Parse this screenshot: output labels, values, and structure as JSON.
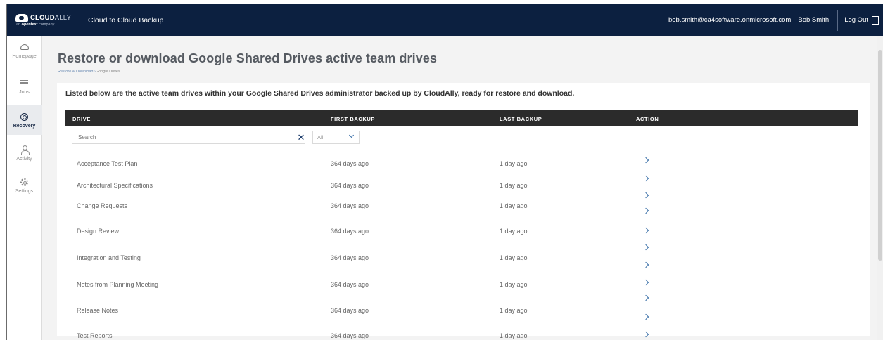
{
  "header": {
    "logo_text_bold": "CLOUD",
    "logo_text_light": "ALLY",
    "logo_sub_prefix": "an",
    "logo_sub_brand": "opentext",
    "logo_sub_suffix": "company",
    "app_title": "Cloud to Cloud Backup",
    "user_email": "bob.smith@ca4software.onmicrosoft.com",
    "user_name": "Bob Smith",
    "logout_label": "Log Out"
  },
  "sidebar": {
    "items": [
      {
        "label": "Homepage",
        "icon": "cloud-icon"
      },
      {
        "label": "Jobs",
        "icon": "stack-icon"
      },
      {
        "label": "Recovery",
        "icon": "recovery-icon",
        "active": true
      },
      {
        "label": "Activity",
        "icon": "person-icon"
      },
      {
        "label": "Settings",
        "icon": "gear-icon"
      }
    ]
  },
  "page": {
    "title": "Restore or download Google Shared Drives active team drives",
    "breadcrumb_parent": "Restore & Download",
    "breadcrumb_sep": " ›",
    "breadcrumb_current": "Google Drives",
    "intro": "Listed below are the active team drives within your Google Shared Drives administrator backed up by CloudAlly, ready for restore and download."
  },
  "table": {
    "columns": [
      "DRIVE",
      "FIRST BACKUP",
      "LAST BACKUP",
      "ACTION"
    ],
    "search_placeholder": "Search",
    "filter_value": "All",
    "rows": [
      {
        "drive": "Acceptance Test Plan",
        "first": "364 days ago",
        "last": "1 day ago"
      },
      {
        "drive": "Architectural Specifications",
        "first": "364 days ago",
        "last": "1 day ago"
      },
      {
        "drive": "Change Requests",
        "first": "364 days ago",
        "last": "1 day ago"
      },
      {
        "drive": "Design Review",
        "first": "364 days ago",
        "last": "1 day ago"
      },
      {
        "drive": "Integration and Testing",
        "first": "364 days ago",
        "last": "1 day ago"
      },
      {
        "drive": "Notes from Planning Meeting",
        "first": "364 days ago",
        "last": "1 day ago"
      },
      {
        "drive": "Release Notes",
        "first": "364 days ago",
        "last": "1 day ago"
      },
      {
        "drive": "Test Reports",
        "first": "364 days ago",
        "last": "1 day ago"
      }
    ]
  },
  "colors": {
    "topbar": "#0c2040",
    "accent": "#3a6fa8",
    "table_header": "#2b2b2b"
  }
}
